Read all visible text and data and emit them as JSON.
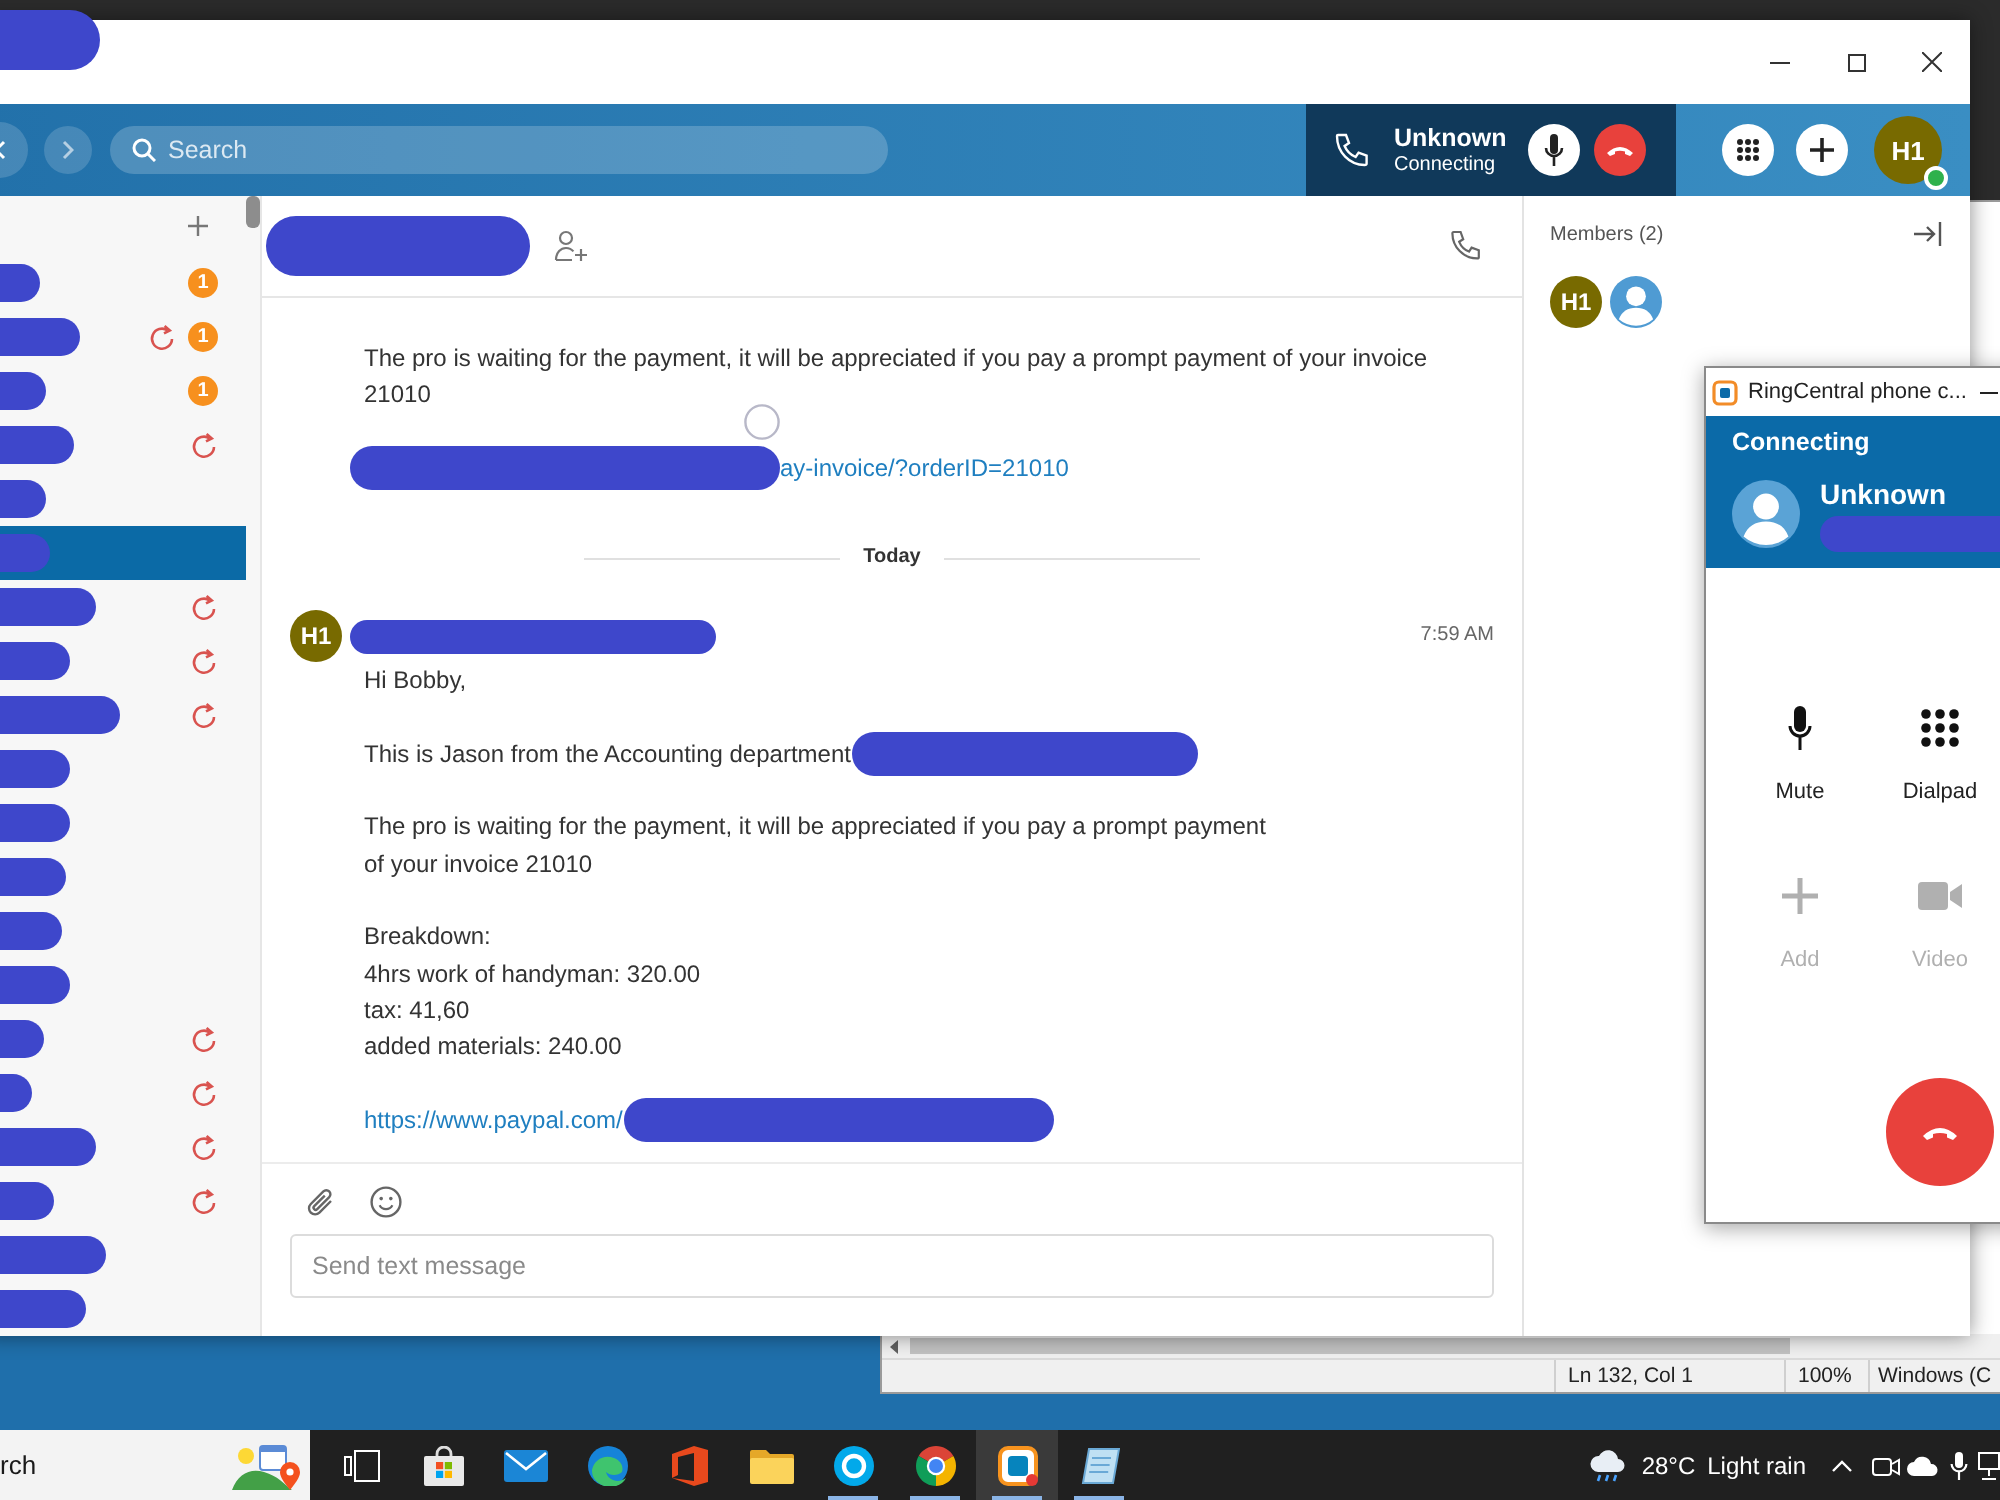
{
  "app_window": {
    "title_redacted": true,
    "header": {
      "search": {
        "placeholder": "Search"
      },
      "call": {
        "caller": "Unknown",
        "status": "Connecting"
      },
      "user": {
        "initials": "H1",
        "online": true
      }
    },
    "sidebar": {
      "items": [
        {
          "redacted": true,
          "unread": "1",
          "retry": false,
          "selected": false
        },
        {
          "redacted": true,
          "unread": "1",
          "retry": true,
          "selected": false
        },
        {
          "redacted": true,
          "unread": "1",
          "retry": false,
          "selected": false
        },
        {
          "redacted": true,
          "retry": true,
          "selected": false
        },
        {
          "redacted": true,
          "retry": false,
          "selected": false
        },
        {
          "redacted": true,
          "retry": false,
          "selected": true
        },
        {
          "redacted": true,
          "retry": true,
          "selected": false
        },
        {
          "redacted": true,
          "retry": true,
          "selected": false
        },
        {
          "redacted": true,
          "retry": true,
          "selected": false
        },
        {
          "redacted": true,
          "retry": false,
          "selected": false
        },
        {
          "redacted": true,
          "retry": false,
          "selected": false
        },
        {
          "redacted": true,
          "retry": false,
          "selected": false
        },
        {
          "redacted": true,
          "retry": false,
          "selected": false
        },
        {
          "redacted": true,
          "retry": false,
          "selected": false
        },
        {
          "redacted": true,
          "retry": true,
          "selected": false
        },
        {
          "redacted": true,
          "retry": true,
          "selected": false
        },
        {
          "redacted": true,
          "retry": true,
          "selected": false
        },
        {
          "redacted": true,
          "retry": true,
          "selected": false
        },
        {
          "redacted": true,
          "retry": false,
          "selected": false
        },
        {
          "redacted": true,
          "retry": false,
          "selected": false
        }
      ]
    },
    "conversation": {
      "title_redacted": true,
      "messages": [
        {
          "kind": "continuation",
          "paragraphs": [
            {
              "kind": "text",
              "lines": [
                "The pro is waiting for the payment, it will be appreciated if you pay a prompt payment of your invoice",
                "21010"
              ]
            },
            {
              "kind": "link",
              "text": "ay-invoice/?orderID=21010",
              "redacted_before": true
            }
          ]
        },
        {
          "kind": "divider",
          "label": "Today"
        },
        {
          "kind": "post",
          "avatar": "H1",
          "sender_redacted": true,
          "time": "7:59 AM",
          "paragraphs": [
            {
              "kind": "text",
              "lines": [
                "Hi Bobby,"
              ]
            },
            {
              "kind": "text",
              "lines": [
                "This is Jason from the Accounting department"
              ],
              "redacted_after": true
            },
            {
              "kind": "text",
              "lines": [
                "The pro is waiting for the payment, it will be appreciated if you pay a prompt payment",
                "of your invoice 21010"
              ]
            },
            {
              "kind": "text",
              "lines": [
                "Breakdown:",
                "4hrs work of handyman: 320.00",
                "tax: 41,60",
                "added materials: 240.00"
              ]
            },
            {
              "kind": "link",
              "text": "https://www.paypal.com/",
              "redacted_after": true
            }
          ]
        }
      ]
    },
    "composer": {
      "placeholder": "Send text message"
    },
    "members_panel": {
      "title": "Members (2)",
      "members": [
        {
          "kind": "initials",
          "initials": "H1"
        },
        {
          "kind": "default"
        }
      ]
    }
  },
  "phone_popup": {
    "title": "RingCentral phone c...",
    "status": "Connecting",
    "caller": "Unknown",
    "number_redacted": true,
    "actions": [
      {
        "kind": "mute",
        "label": "Mute",
        "disabled": false
      },
      {
        "kind": "dialpad",
        "label": "Dialpad",
        "disabled": false
      },
      {
        "kind": "add",
        "label": "Add",
        "disabled": true
      },
      {
        "kind": "video",
        "label": "Video",
        "disabled": true
      }
    ]
  },
  "editor_window": {
    "status_items": [
      "Ln 132, Col 1",
      "100%",
      "Windows (C"
    ]
  },
  "taskbar": {
    "search": {
      "placeholder": "rch"
    },
    "apps": [
      {
        "kind": "taskview",
        "selected": false,
        "running": false
      },
      {
        "kind": "store",
        "selected": false,
        "running": false
      },
      {
        "kind": "mail",
        "selected": false,
        "running": false
      },
      {
        "kind": "edge",
        "selected": false,
        "running": false
      },
      {
        "kind": "office",
        "selected": false,
        "running": false
      },
      {
        "kind": "folder",
        "selected": false,
        "running": false
      },
      {
        "kind": "skype",
        "selected": false,
        "running": true
      },
      {
        "kind": "chrome",
        "selected": false,
        "running": true
      },
      {
        "kind": "ringcentral",
        "selected": true,
        "running": true
      },
      {
        "kind": "notes",
        "selected": false,
        "running": true
      }
    ],
    "weather": {
      "temperature": "28°C",
      "condition": "Light rain"
    }
  }
}
